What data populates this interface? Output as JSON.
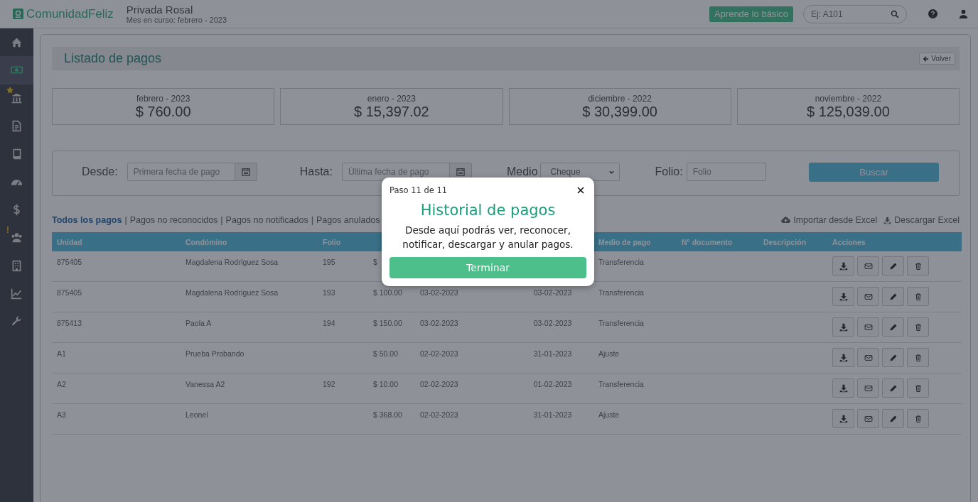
{
  "topbar": {
    "logo": "ComunidadFeliz",
    "property": "Privada Rosal",
    "current_month": "Mes en curso: febrero - 2023",
    "learn_button": "Aprende lo básico",
    "search": {
      "placeholder": "Ej: A101"
    }
  },
  "sidebar": {
    "items": [
      {
        "selected": false,
        "starred": false
      },
      {
        "selected": true,
        "starred": false
      },
      {
        "selected": false,
        "starred": true
      },
      {
        "selected": false,
        "starred": false
      },
      {
        "selected": false,
        "starred": false
      },
      {
        "selected": false,
        "starred": false
      },
      {
        "selected": false,
        "starred": false
      },
      {
        "selected": false,
        "starred": false,
        "badge": "!"
      },
      {
        "selected": false,
        "starred": false
      },
      {
        "selected": false,
        "starred": false
      },
      {
        "selected": false,
        "starred": false
      }
    ]
  },
  "page": {
    "title": "Listado de pagos",
    "back_button": "Volver"
  },
  "summaries": [
    {
      "period": "febrero - 2023",
      "amount": "$ 760.00"
    },
    {
      "period": "enero - 2023",
      "amount": "$ 15,397.02"
    },
    {
      "period": "diciembre - 2022",
      "amount": "$ 30,399.00"
    },
    {
      "period": "noviembre - 2022",
      "amount": "$ 125,039.00"
    }
  ],
  "filters": {
    "from_label": "Desde:",
    "from_placeholder": "Primera fecha de pago",
    "to_label": "Hasta:",
    "to_placeholder": "Última fecha de pago",
    "method_label": "Medio",
    "method_value": "Cheque",
    "folio_label": "Folio:",
    "folio_placeholder": "Folio",
    "search_button": "Buscar"
  },
  "filter_tabs": [
    {
      "label": "Todos los pagos",
      "selected": true
    },
    {
      "label": "Pagos no reconocidos",
      "selected": false
    },
    {
      "label": "Pagos no notificados",
      "selected": false
    },
    {
      "label": "Pagos anulados",
      "selected": false
    }
  ],
  "tab_separators": [
    "|",
    "|",
    "|"
  ],
  "excel_actions": [
    {
      "kind": "import",
      "label": "Importar desde Excel"
    },
    {
      "kind": "download",
      "label": "Descargar Excel"
    }
  ],
  "table": {
    "columns": [
      {
        "label": "Unidad"
      },
      {
        "label": "Condómino"
      },
      {
        "label": "Folio"
      },
      {},
      {},
      {},
      {
        "label": "Medio de pago"
      },
      {
        "label": "N° documento"
      },
      {
        "label": "Descripción"
      },
      {
        "label": "Acciones"
      }
    ],
    "rows": [
      {
        "unit": "875405",
        "resident": "Magdalena Rodríguez Sosa",
        "folio": "195",
        "amount": "$",
        "method": "Transferencia"
      },
      {
        "unit": "875405",
        "resident": "Magdalena Rodríguez Sosa",
        "folio": "193",
        "amount": "$ 100.00",
        "paid_date": "03-02-2023",
        "registered_date": "03-02-2023",
        "method": "Transferencia"
      },
      {
        "unit": "875413",
        "resident": "Paola A",
        "folio": "194",
        "amount": "$ 150.00",
        "paid_date": "03-02-2023",
        "registered_date": "03-02-2023",
        "method": "Transferencia"
      },
      {
        "unit": "A1",
        "resident": "Prueba Probando",
        "amount": "$ 50.00",
        "paid_date": "02-02-2023",
        "registered_date": "31-01-2023",
        "method": "Ajuste"
      },
      {
        "unit": "A2",
        "resident": "Vanessa A2",
        "folio": "192",
        "amount": "$ 10.00",
        "paid_date": "02-02-2023",
        "registered_date": "01-02-2023",
        "method": "Transferencia"
      },
      {
        "unit": "A3",
        "resident": "Leonel",
        "amount": "$ 368.00",
        "paid_date": "02-02-2023",
        "registered_date": "31-01-2023",
        "method": "Ajuste"
      }
    ]
  },
  "tour": {
    "step": "Paso 11 de 11",
    "title": "Historial de pagos",
    "body": "Desde aquí podrás ver, reconocer, notificar, descargar y anular pagos.",
    "button": "Terminar"
  }
}
